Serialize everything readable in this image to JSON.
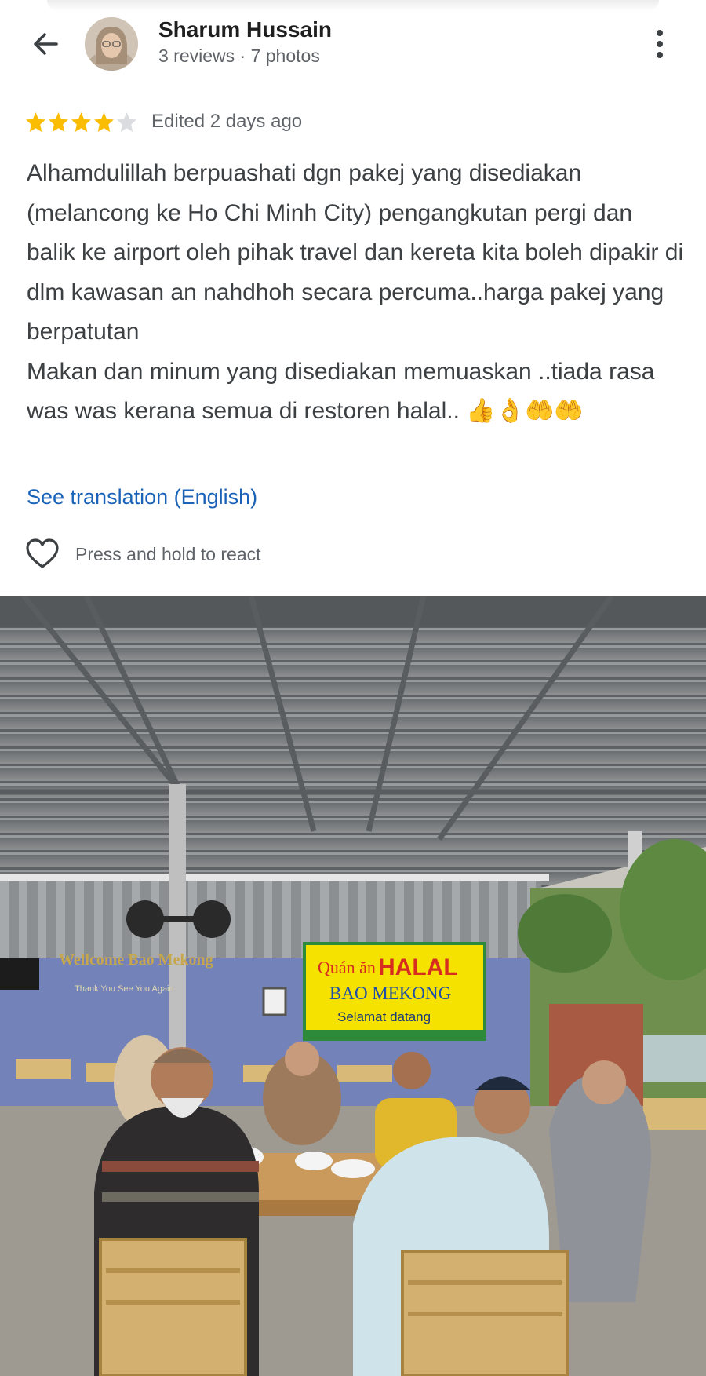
{
  "header": {
    "reviewer_name": "Sharum Hussain",
    "reviewer_meta": "3 reviews · 7 photos",
    "back_icon": "arrow-left-icon",
    "menu_icon": "more-vertical-icon"
  },
  "review": {
    "rating": 4,
    "max_rating": 5,
    "edited": "Edited 2 days ago",
    "text": "Alhamdulillah berpuashati dgn pakej yang disediakan (melancong ke Ho Chi Minh City) pengangkutan pergi dan balik ke airport oleh pihak travel dan kereta kita boleh dipakir di dlm kawasan an nahdhoh secara percuma..harga pakej yang berpatutan\nMakan dan minum yang disediakan memuaskan ..tiada rasa was was kerana semua di restoren halal.. 👍👌🤲🤲",
    "translation_link": "See translation (English)",
    "react_label": "Press and hold to react"
  },
  "photo": {
    "sign_line1_prefix": "Quán ăn",
    "sign_line1_main": "HALAL",
    "sign_line2": "BAO MEKONG",
    "sign_line3": "Selamat datang",
    "wall_text": "Wellcome Bao Mekong",
    "wall_subtext": "Thank You     See You Again"
  },
  "colors": {
    "star_filled": "#fbbc04",
    "star_empty": "#dadce0",
    "link": "#1a62b8",
    "sign_bg": "#f5e200",
    "sign_red": "#d62d20",
    "sign_blue": "#1f4fa8",
    "wall": "#7382b8"
  }
}
